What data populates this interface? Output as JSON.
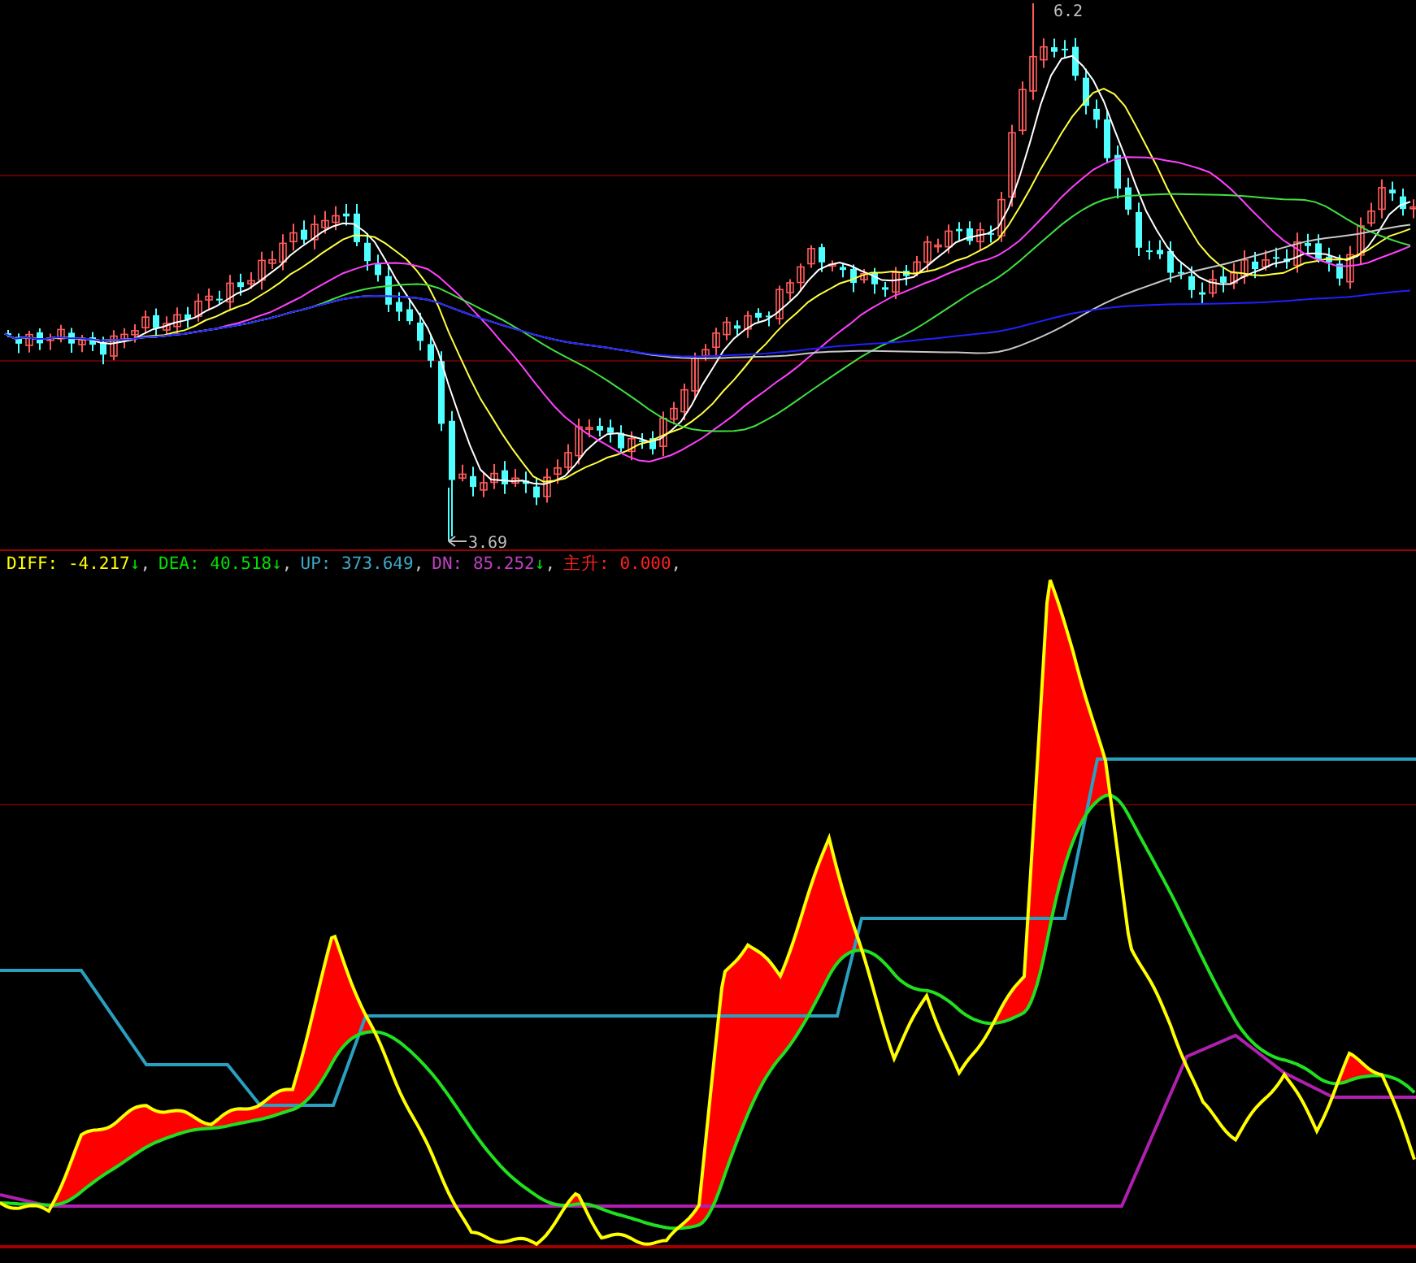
{
  "price_chart": {
    "high_label": "6.2",
    "low_label": "3.69"
  },
  "indicator": {
    "legend": [
      {
        "label": "DIFF:",
        "value": "-4.217",
        "trend": "↓",
        "sep": ",",
        "color": "#ffff00"
      },
      {
        "label": "DEA:",
        "value": "40.518",
        "trend": "↓",
        "sep": ",",
        "color": "#00e000"
      },
      {
        "label": "UP:",
        "value": "373.649",
        "sep": ",",
        "color": "#3aa8c8"
      },
      {
        "label": "DN:",
        "value": "85.252",
        "trend": "↓",
        "sep": ",",
        "color": "#c040c0"
      },
      {
        "label": "主升:",
        "value": "0.000",
        "sep": ",",
        "color": "#ff2020"
      }
    ]
  }
}
